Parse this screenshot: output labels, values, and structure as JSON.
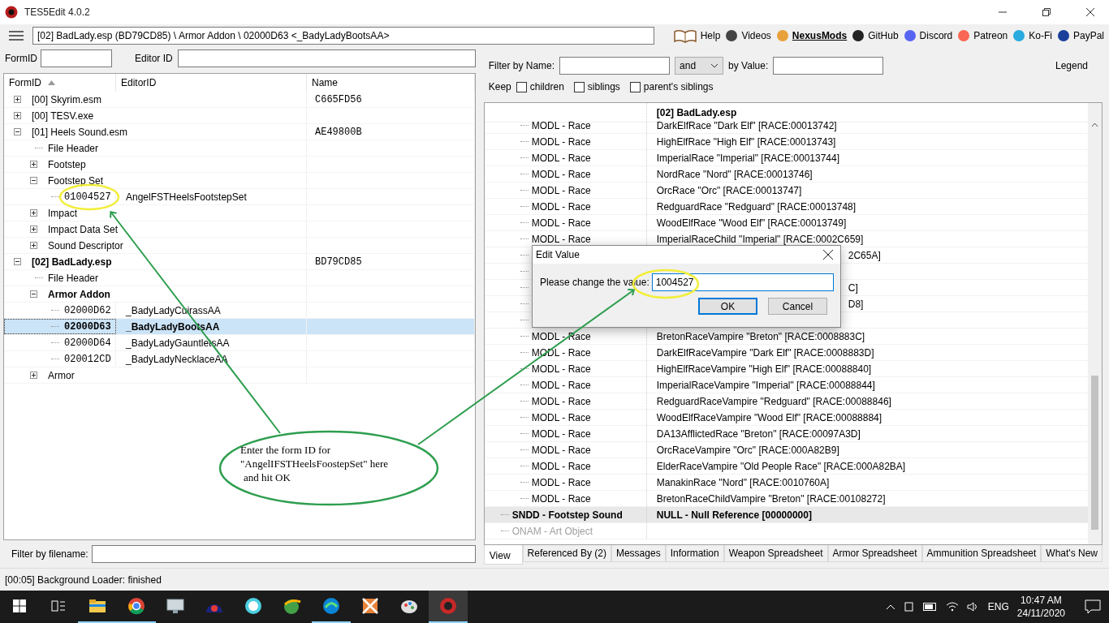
{
  "window": {
    "title": "TES5Edit 4.0.2"
  },
  "toolbar": {
    "path": "[02] BadLady.esp (BD79CD85) \\ Armor Addon \\ 02000D63 <_BadyLadyBootsAA>",
    "links": [
      {
        "label": "Help",
        "emphasized": false
      },
      {
        "label": "Videos",
        "emphasized": false
      },
      {
        "label": "NexusMods",
        "emphasized": true
      },
      {
        "label": "GitHub",
        "emphasized": false
      },
      {
        "label": "Discord",
        "emphasized": false
      },
      {
        "label": "Patreon",
        "emphasized": false
      },
      {
        "label": "Ko-Fi",
        "emphasized": false
      },
      {
        "label": "PayPal",
        "emphasized": false
      }
    ]
  },
  "left": {
    "search": [
      {
        "label": "FormID"
      },
      {
        "label": "Editor ID"
      }
    ],
    "columns": [
      "FormID",
      "EditorID",
      "Name"
    ],
    "tree": [
      {
        "kind": "group",
        "label": "[00] Skyrim.esm",
        "name": "C665FD56",
        "bold": false,
        "expanded": false,
        "selected": false
      },
      {
        "kind": "group",
        "label": "[00] TESV.exe",
        "bold": false,
        "expanded": false,
        "selected": false
      },
      {
        "kind": "group",
        "label": "[01] Heels Sound.esm",
        "name": "AE49800B",
        "bold": false,
        "expanded": true,
        "selected": false,
        "children": [
          {
            "kind": "group",
            "label": "File Header",
            "bold": false,
            "selected": false
          },
          {
            "kind": "group",
            "label": "Footstep",
            "bold": false,
            "expanded": false,
            "selected": false
          },
          {
            "kind": "group",
            "label": "Footstep Set",
            "bold": false,
            "expanded": true,
            "selected": false,
            "children": [
              {
                "kind": "record",
                "form_id": "01004527",
                "editor_id": "AngelFSTHeelsFootstepSet",
                "bold": false,
                "selected": false
              }
            ]
          },
          {
            "kind": "group",
            "label": "Impact",
            "bold": false,
            "expanded": false,
            "selected": false
          },
          {
            "kind": "group",
            "label": "Impact Data Set",
            "bold": false,
            "expanded": false,
            "selected": false
          },
          {
            "kind": "group",
            "label": "Sound Descriptor",
            "bold": false,
            "expanded": false,
            "selected": false
          }
        ]
      },
      {
        "kind": "group",
        "label": "[02] BadLady.esp",
        "name": "BD79CD85",
        "bold": true,
        "expanded": true,
        "selected": false,
        "children": [
          {
            "kind": "group",
            "label": "File Header",
            "bold": false,
            "selected": false
          },
          {
            "kind": "group",
            "label": "Armor Addon",
            "bold": true,
            "expanded": true,
            "selected": false,
            "children": [
              {
                "kind": "record",
                "form_id": "02000D62",
                "editor_id": "_BadyLadyCuirassAA",
                "bold": false,
                "selected": false
              },
              {
                "kind": "record",
                "form_id": "02000D63",
                "editor_id": "_BadyLadyBootsAA",
                "bold": true,
                "selected": true
              },
              {
                "kind": "record",
                "form_id": "02000D64",
                "editor_id": "_BadyLadyGauntletsAA",
                "bold": false,
                "selected": false
              },
              {
                "kind": "record",
                "form_id": "020012CD",
                "editor_id": "_BadyLadyNecklaceAA",
                "bold": false,
                "selected": false
              }
            ]
          },
          {
            "kind": "group",
            "label": "Armor",
            "bold": false,
            "expanded": false,
            "selected": false
          }
        ]
      }
    ],
    "filter_label": "Filter by filename:"
  },
  "right": {
    "filter_name_label": "Filter by Name:",
    "operator": "and",
    "value_label": "by Value:",
    "legend": "Legend",
    "keep_label": "Keep",
    "keep_options": [
      {
        "label": "children",
        "checked": false
      },
      {
        "label": "siblings",
        "checked": false
      },
      {
        "label": "parent's siblings",
        "checked": false
      }
    ],
    "header": "[02] BadLady.esp",
    "rows": [
      {
        "kind": "entry",
        "name": "MODL - Race",
        "value": "DarkElfRace \"Dark Elf\" [RACE:00013742]"
      },
      {
        "kind": "entry",
        "name": "MODL - Race",
        "value": "HighElfRace \"High Elf\" [RACE:00013743]"
      },
      {
        "kind": "entry",
        "name": "MODL - Race",
        "value": "ImperialRace \"Imperial\" [RACE:00013744]"
      },
      {
        "kind": "entry",
        "name": "MODL - Race",
        "value": "NordRace \"Nord\" [RACE:00013746]"
      },
      {
        "kind": "entry",
        "name": "MODL - Race",
        "value": "OrcRace \"Orc\" [RACE:00013747]"
      },
      {
        "kind": "entry",
        "name": "MODL - Race",
        "value": "RedguardRace \"Redguard\" [RACE:00013748]"
      },
      {
        "kind": "entry",
        "name": "MODL - Race",
        "value": "WoodElfRace \"Wood Elf\" [RACE:00013749]"
      },
      {
        "kind": "entry",
        "name": "MODL - Race",
        "value": "ImperialRaceChild \"Imperial\" [RACE:0002C659]"
      },
      {
        "kind": "covered",
        "tail": "2C65A]"
      },
      {
        "kind": "covered"
      },
      {
        "kind": "covered",
        "tail": "C]"
      },
      {
        "kind": "covered",
        "tail": "D8]"
      },
      {
        "kind": "covered"
      },
      {
        "kind": "entry",
        "name": "MODL - Race",
        "value": "BretonRaceVampire \"Breton\" [RACE:0008883C]"
      },
      {
        "kind": "entry",
        "name": "MODL - Race",
        "value": "DarkElfRaceVampire \"Dark Elf\" [RACE:0008883D]"
      },
      {
        "kind": "entry",
        "name": "MODL - Race",
        "value": "HighElfRaceVampire \"High Elf\" [RACE:00088840]"
      },
      {
        "kind": "entry",
        "name": "MODL - Race",
        "value": "ImperialRaceVampire \"Imperial\" [RACE:00088844]"
      },
      {
        "kind": "entry",
        "name": "MODL - Race",
        "value": "RedguardRaceVampire \"Redguard\" [RACE:00088846]"
      },
      {
        "kind": "entry",
        "name": "MODL - Race",
        "value": "WoodElfRaceVampire \"Wood Elf\" [RACE:00088884]"
      },
      {
        "kind": "entry",
        "name": "MODL - Race",
        "value": "DA13AfflictedRace \"Breton\" [RACE:00097A3D]"
      },
      {
        "kind": "entry",
        "name": "MODL - Race",
        "value": "OrcRaceVampire \"Orc\" [RACE:000A82B9]"
      },
      {
        "kind": "entry",
        "name": "MODL - Race",
        "value": "ElderRaceVampire \"Old People Race\" [RACE:000A82BA]"
      },
      {
        "kind": "entry",
        "name": "MODL - Race",
        "value": "ManakinRace \"Nord\" [RACE:0010760A]"
      },
      {
        "kind": "entry",
        "name": "MODL - Race",
        "value": "BretonRaceChildVampire \"Breton\" [RACE:00108272]"
      },
      {
        "kind": "reference",
        "name": "SNDD - Footstep Sound",
        "value": "NULL - Null Reference [00000000]"
      },
      {
        "kind": "unused",
        "name": "ONAM - Art Object"
      }
    ],
    "tabs": [
      {
        "label": "View",
        "selected": true
      },
      {
        "label": "Referenced By (2)",
        "selected": false
      },
      {
        "label": "Messages",
        "selected": false
      },
      {
        "label": "Information",
        "selected": false
      },
      {
        "label": "Weapon Spreadsheet",
        "selected": false
      },
      {
        "label": "Armor Spreadsheet",
        "selected": false
      },
      {
        "label": "Ammunition Spreadsheet",
        "selected": false
      },
      {
        "label": "What's New",
        "selected": false
      }
    ]
  },
  "dialog": {
    "title": "Edit Value",
    "prompt": "Please change the value:",
    "value": "1004527",
    "buttons": [
      {
        "label": "OK",
        "focused": true
      },
      {
        "label": "Cancel",
        "focused": false
      }
    ]
  },
  "note": {
    "lines": [
      "Enter the form ID for",
      "\"AngelIFSTHeelsFoostepSet\" here",
      "and hit OK"
    ]
  },
  "status": "[00:05] Background Loader: finished",
  "tray": {
    "language": "ENG",
    "time": "10:47 AM",
    "date": "24/11/2020"
  }
}
